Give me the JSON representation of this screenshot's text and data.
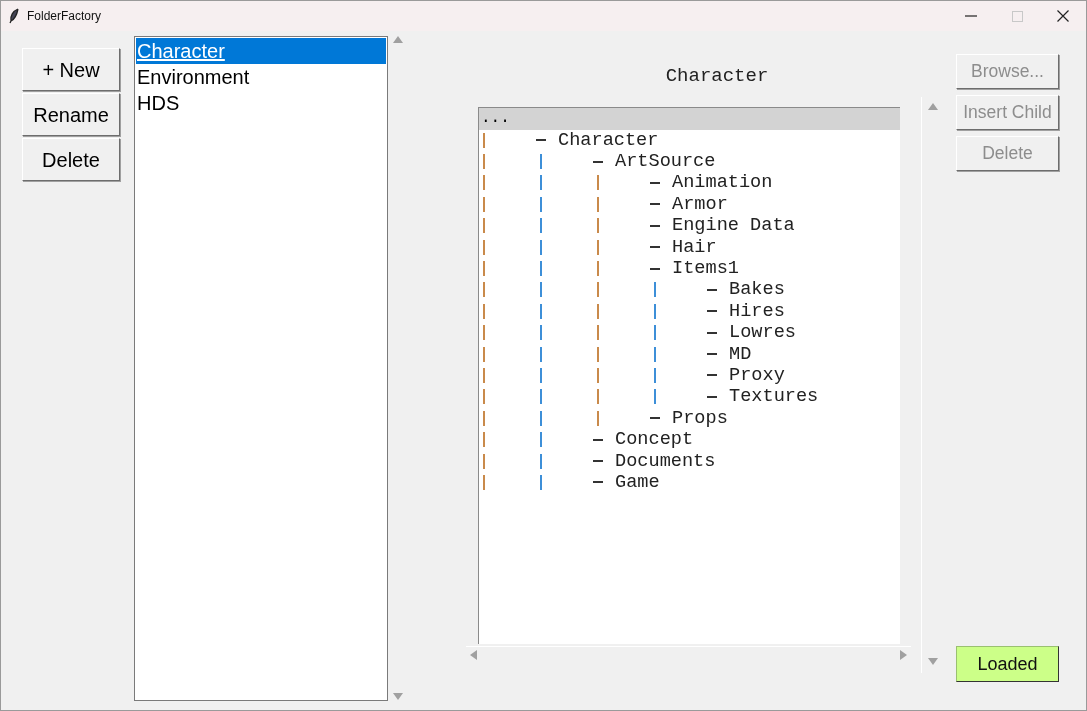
{
  "window": {
    "title": "FolderFactory"
  },
  "left_buttons": [
    {
      "label": "+ New"
    },
    {
      "label": "Rename"
    },
    {
      "label": "Delete"
    }
  ],
  "projects": [
    {
      "label": "Character",
      "selected": true
    },
    {
      "label": "Environment",
      "selected": false
    },
    {
      "label": "HDS",
      "selected": false
    }
  ],
  "heading": "Character",
  "tree": {
    "header": "...",
    "nodes": [
      {
        "label": "Character",
        "children": [
          {
            "label": "ArtSource",
            "children": [
              {
                "label": "Animation"
              },
              {
                "label": "Armor"
              },
              {
                "label": "Engine Data"
              },
              {
                "label": "Hair"
              },
              {
                "label": "Items1",
                "children": [
                  {
                    "label": "Bakes"
                  },
                  {
                    "label": "Hires"
                  },
                  {
                    "label": "Lowres"
                  },
                  {
                    "label": "MD"
                  },
                  {
                    "label": "Proxy"
                  },
                  {
                    "label": "Textures"
                  }
                ]
              },
              {
                "label": "Props"
              }
            ]
          },
          {
            "label": "Concept"
          },
          {
            "label": "Documents"
          },
          {
            "label": "Game"
          }
        ]
      }
    ]
  },
  "right_buttons": [
    {
      "label": "Browse...",
      "disabled": true
    },
    {
      "label": "Insert Child",
      "disabled": true
    },
    {
      "label": "Delete",
      "disabled": true
    }
  ],
  "status": {
    "label": "Loaded"
  }
}
